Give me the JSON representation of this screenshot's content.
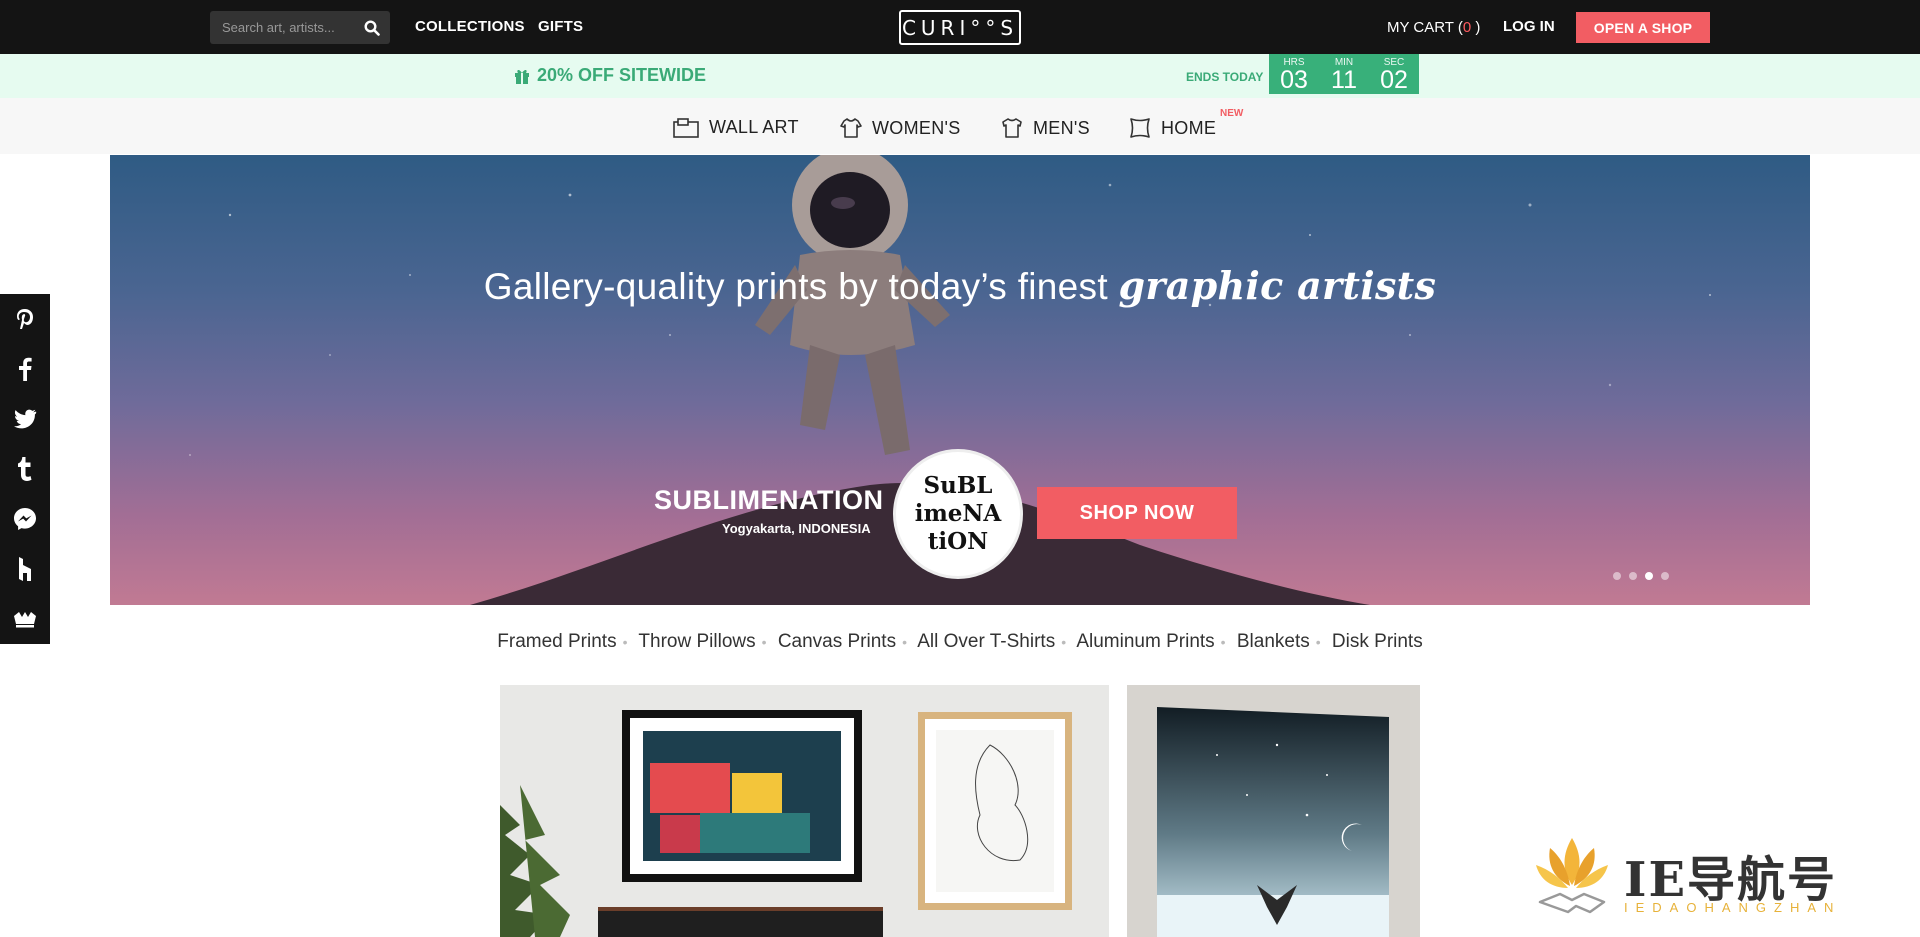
{
  "header": {
    "search_placeholder": "Search art, artists...",
    "nav": [
      "COLLECTIONS",
      "GIFTS"
    ],
    "logo": "CURI°°S",
    "cart_label": "MY CART (",
    "cart_count": "0",
    "cart_close": " )",
    "login": "LOG IN",
    "open_shop": "OPEN A SHOP"
  },
  "promo": {
    "text": "20% OFF SITEWIDE",
    "ends": "ENDS TODAY",
    "timer": [
      {
        "label": "HRS",
        "value": "03"
      },
      {
        "label": "MIN",
        "value": "11"
      },
      {
        "label": "SEC",
        "value": "02"
      }
    ]
  },
  "categories": [
    "WALL ART",
    "WOMEN'S",
    "MEN'S",
    "HOME"
  ],
  "new_badge": "NEW",
  "hero": {
    "title_plain": "Gallery-quality prints by today’s finest ",
    "title_script": "graphic artists",
    "artist_name": "SUBLIMENATION",
    "artist_location": "Yogyakarta, INDONESIA",
    "badge_lines": [
      "SuBL",
      "imeNA",
      "tiON"
    ],
    "cta": "SHOP NOW",
    "slides": 4,
    "active_slide": 3
  },
  "product_types": [
    "Framed Prints",
    "Throw Pillows",
    "Canvas Prints",
    "All Over T-Shirts",
    "Aluminum Prints",
    "Blankets",
    "Disk Prints"
  ],
  "social": [
    "pinterest-icon",
    "facebook-icon",
    "twitter-icon",
    "tumblr-icon",
    "messenger-icon",
    "houzz-icon",
    "sumo-icon"
  ],
  "watermark": {
    "text": "IE导航号",
    "sub": "IEDAOHANGZHAN"
  },
  "colors": {
    "accent": "#f25d63",
    "promo_green": "#38b07a",
    "topbar": "#141414"
  }
}
